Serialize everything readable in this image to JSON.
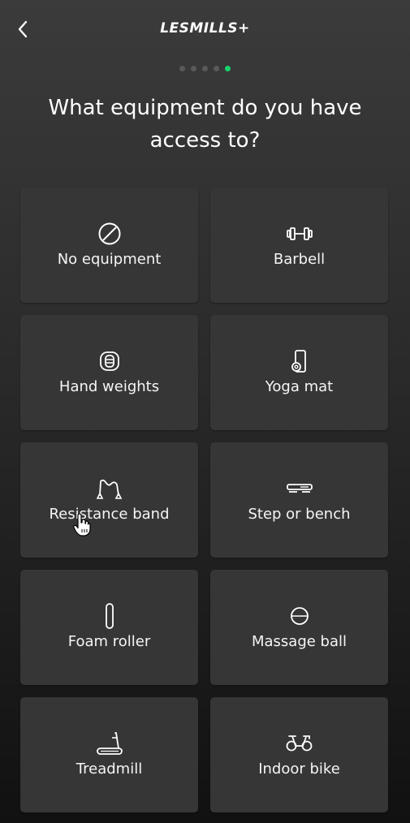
{
  "header": {
    "back_icon": "chevron-left-icon",
    "logo_text": "LESMILLS+"
  },
  "progress": {
    "total_steps": 5,
    "current_step": 5,
    "inactive_color": "#5a5a5a",
    "active_color": "#19d46a"
  },
  "title": {
    "line1": "What equipment do you have",
    "line2": "access to?"
  },
  "equipment": [
    {
      "label": "No equipment",
      "icon": "no-equipment-icon"
    },
    {
      "label": "Barbell",
      "icon": "barbell-icon"
    },
    {
      "label": "Hand weights",
      "icon": "hand-weights-icon"
    },
    {
      "label": "Yoga mat",
      "icon": "yoga-mat-icon"
    },
    {
      "label": "Resistance band",
      "icon": "resistance-band-icon"
    },
    {
      "label": "Step or bench",
      "icon": "step-bench-icon"
    },
    {
      "label": "Foam roller",
      "icon": "foam-roller-icon"
    },
    {
      "label": "Massage ball",
      "icon": "massage-ball-icon"
    },
    {
      "label": "Treadmill",
      "icon": "treadmill-icon"
    },
    {
      "label": "Indoor bike",
      "icon": "indoor-bike-icon"
    }
  ],
  "colors": {
    "card_background": "#363636",
    "text": "#ffffff"
  }
}
